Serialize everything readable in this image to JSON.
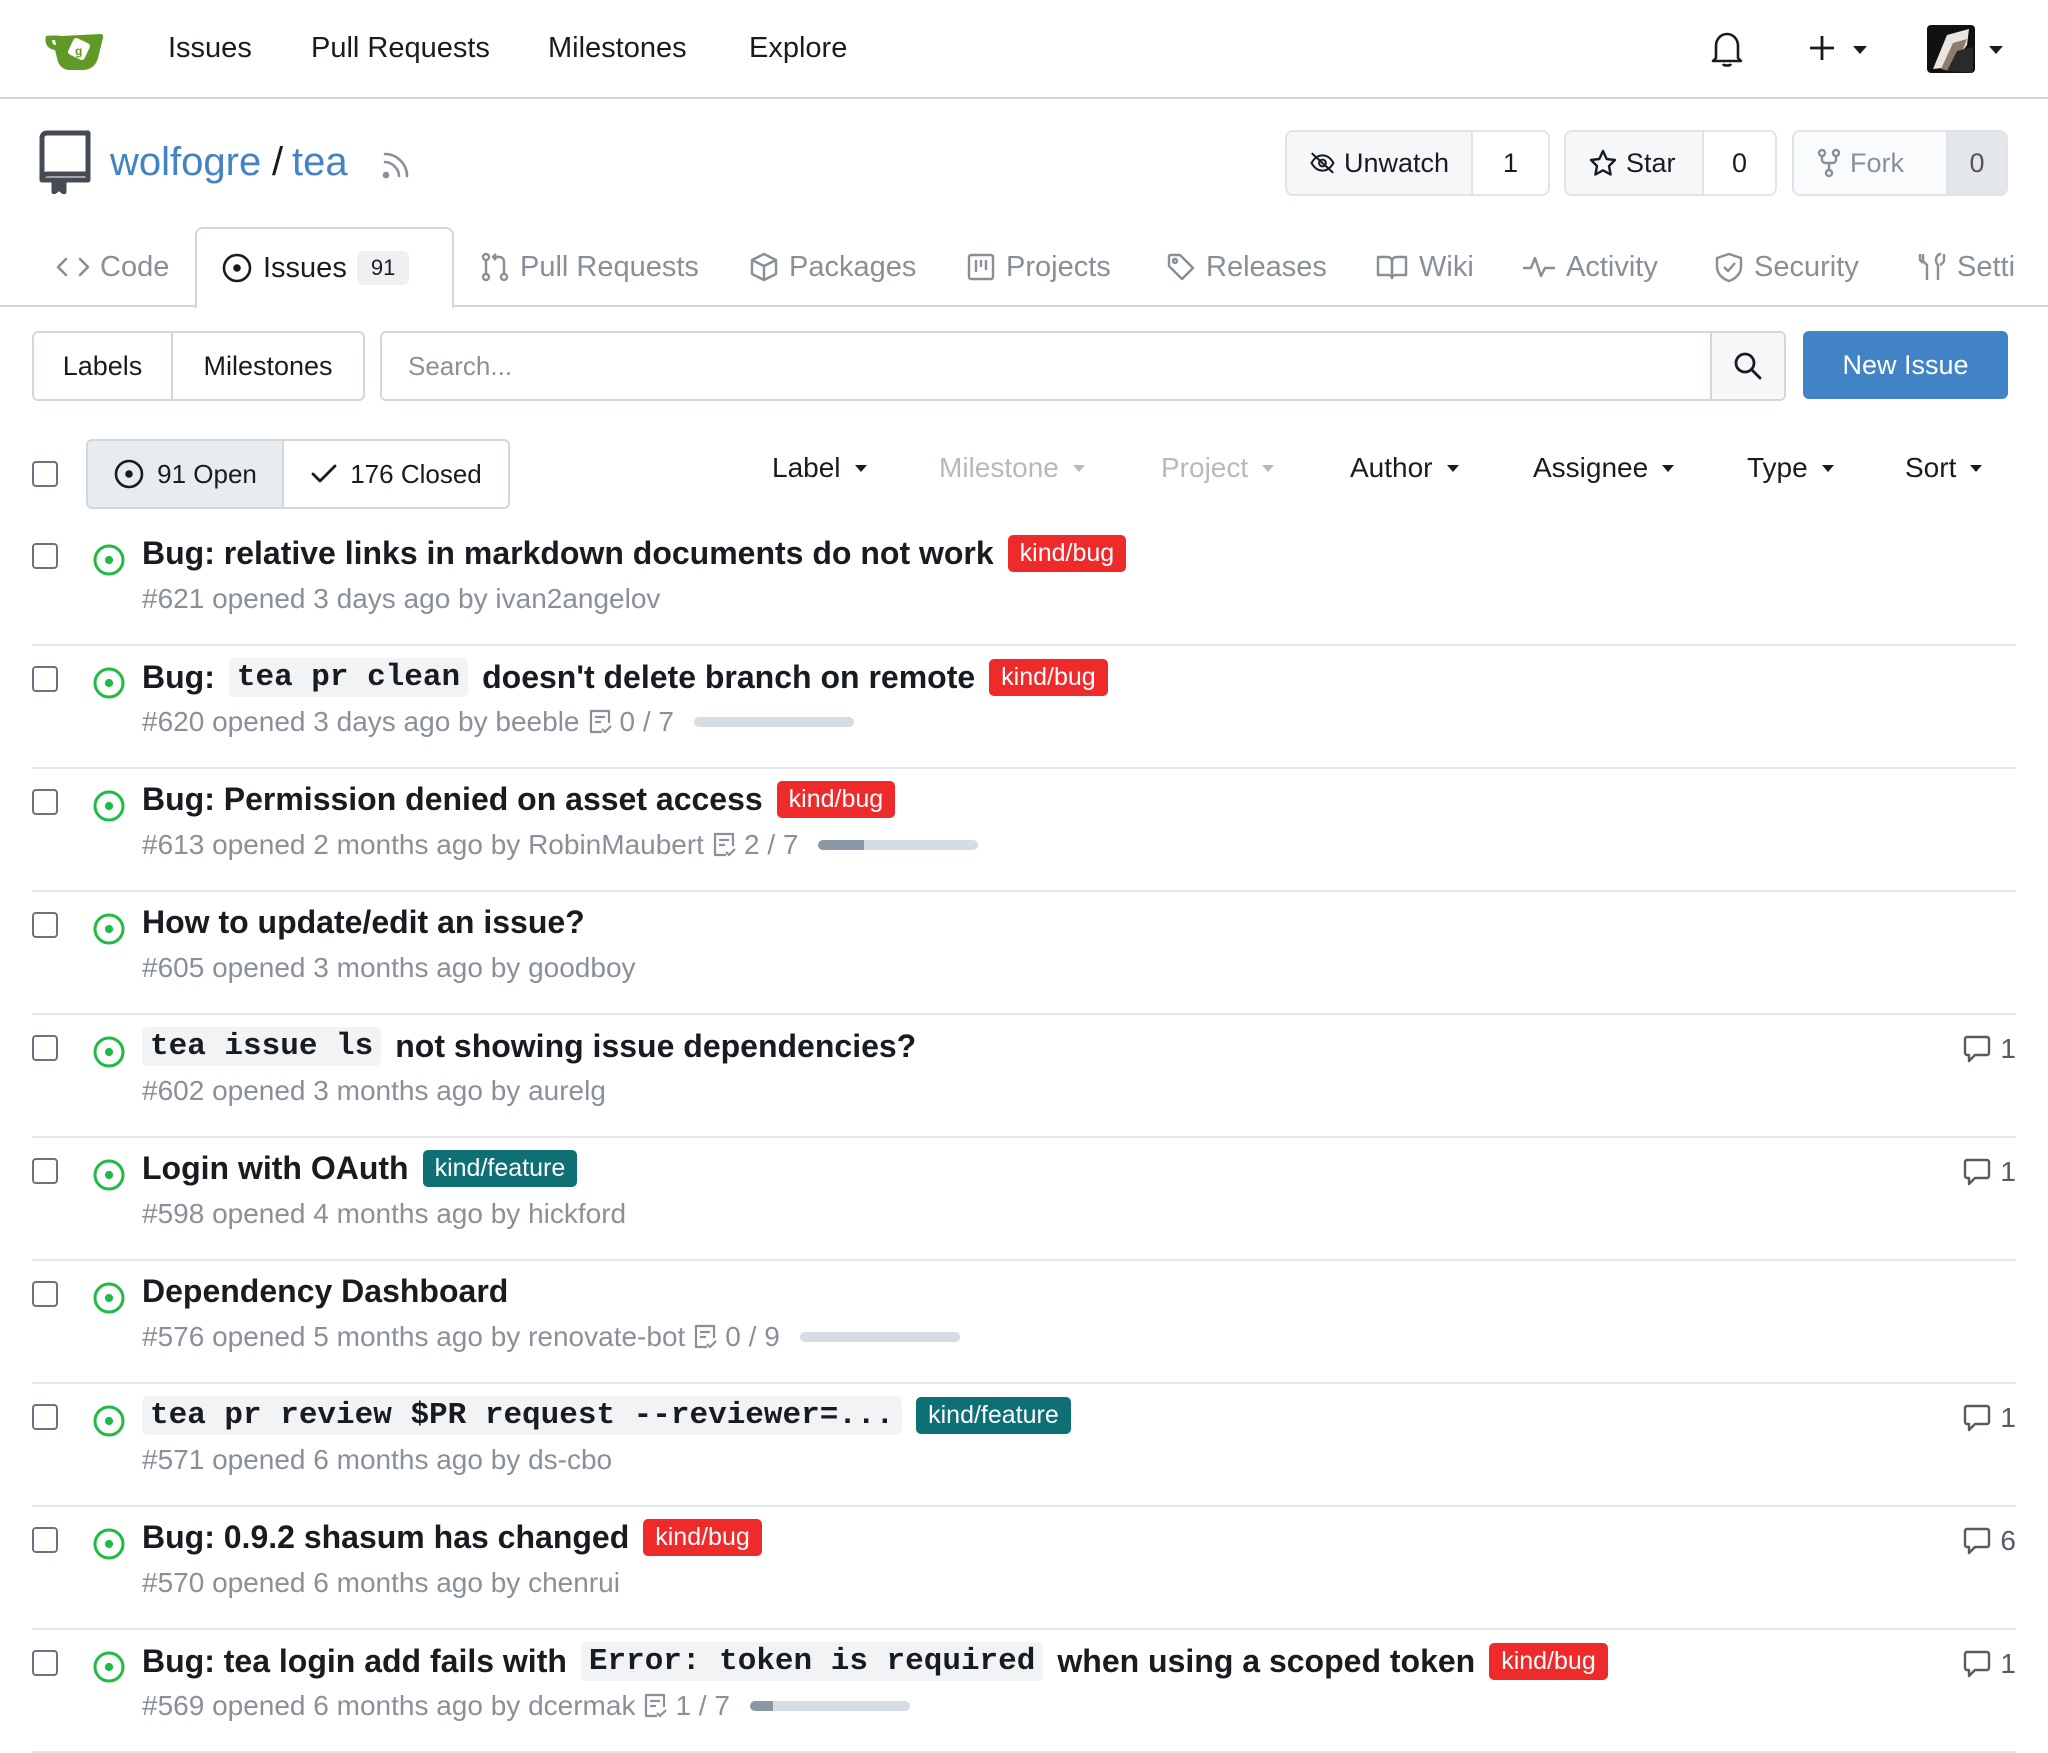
{
  "topnav": {
    "links": [
      "Issues",
      "Pull Requests",
      "Milestones",
      "Explore"
    ]
  },
  "repo": {
    "owner": "wolfogre",
    "sep": "/",
    "name": "tea",
    "watch": {
      "label": "Unwatch",
      "count": "1"
    },
    "star": {
      "label": "Star",
      "count": "0"
    },
    "fork": {
      "label": "Fork",
      "count": "0"
    }
  },
  "tabs": {
    "code": "Code",
    "issues": "Issues",
    "issues_count": "91",
    "pulls": "Pull Requests",
    "packages": "Packages",
    "projects": "Projects",
    "releases": "Releases",
    "wiki": "Wiki",
    "activity": "Activity",
    "security": "Security",
    "settings": "Setti"
  },
  "filterbar": {
    "labels": "Labels",
    "milestones": "Milestones",
    "search_placeholder": "Search...",
    "new_issue": "New Issue",
    "open": "91 Open",
    "closed": "176 Closed",
    "filters": {
      "label": "Label",
      "milestone": "Milestone",
      "project": "Project",
      "author": "Author",
      "assignee": "Assignee",
      "type": "Type",
      "sort": "Sort"
    }
  },
  "colors": {
    "accent": "#4183c4",
    "bug": "#ee2a2a",
    "feature": "#0e6f74",
    "open": "#21ba45"
  },
  "issues": [
    {
      "title_parts": [
        {
          "t": "Bug: relative links in markdown documents do not work"
        }
      ],
      "label": "kind/bug",
      "label_kind": "bug",
      "meta": "#621 opened 3 days ago by ivan2angelov",
      "tasks": "",
      "progress": null,
      "comments": ""
    },
    {
      "title_parts": [
        {
          "t": "Bug:"
        },
        {
          "t": "tea pr clean",
          "code": true
        },
        {
          "t": "doesn't delete branch on remote"
        }
      ],
      "label": "kind/bug",
      "label_kind": "bug",
      "meta": "#620 opened 3 days ago by beeble",
      "tasks": "0 / 7",
      "progress": 0.0,
      "comments": ""
    },
    {
      "title_parts": [
        {
          "t": "Bug: Permission denied on asset access"
        }
      ],
      "label": "kind/bug",
      "label_kind": "bug",
      "meta": "#613 opened 2 months ago by RobinMaubert",
      "tasks": "2 / 7",
      "progress": 0.286,
      "comments": ""
    },
    {
      "title_parts": [
        {
          "t": "How to update/edit an issue?"
        }
      ],
      "label": "",
      "label_kind": "",
      "meta": "#605 opened 3 months ago by goodboy",
      "tasks": "",
      "progress": null,
      "comments": ""
    },
    {
      "title_parts": [
        {
          "t": "tea issue ls",
          "code": true
        },
        {
          "t": "not showing issue dependencies?"
        }
      ],
      "label": "",
      "label_kind": "",
      "meta": "#602 opened 3 months ago by aurelg",
      "tasks": "",
      "progress": null,
      "comments": "1"
    },
    {
      "title_parts": [
        {
          "t": "Login with OAuth"
        }
      ],
      "label": "kind/feature",
      "label_kind": "feature",
      "meta": "#598 opened 4 months ago by hickford",
      "tasks": "",
      "progress": null,
      "comments": "1"
    },
    {
      "title_parts": [
        {
          "t": "Dependency Dashboard"
        }
      ],
      "label": "",
      "label_kind": "",
      "meta": "#576 opened 5 months ago by renovate-bot",
      "tasks": "0 / 9",
      "progress": 0.0,
      "comments": ""
    },
    {
      "title_parts": [
        {
          "t": "tea pr review $PR request --reviewer=...",
          "code": true
        }
      ],
      "label": "kind/feature",
      "label_kind": "feature",
      "meta": "#571 opened 6 months ago by ds-cbo",
      "tasks": "",
      "progress": null,
      "comments": "1"
    },
    {
      "title_parts": [
        {
          "t": "Bug: 0.9.2 shasum has changed"
        }
      ],
      "label": "kind/bug",
      "label_kind": "bug",
      "meta": "#570 opened 6 months ago by chenrui",
      "tasks": "",
      "progress": null,
      "comments": "6"
    },
    {
      "title_parts": [
        {
          "t": "Bug: tea login add fails with"
        },
        {
          "t": "Error: token is required",
          "code": true
        },
        {
          "t": "when using a scoped token"
        }
      ],
      "label": "kind/bug",
      "label_kind": "bug",
      "meta": "#569 opened 6 months ago by dcermak",
      "tasks": "1 / 7",
      "progress": 0.143,
      "comments": "1"
    }
  ]
}
